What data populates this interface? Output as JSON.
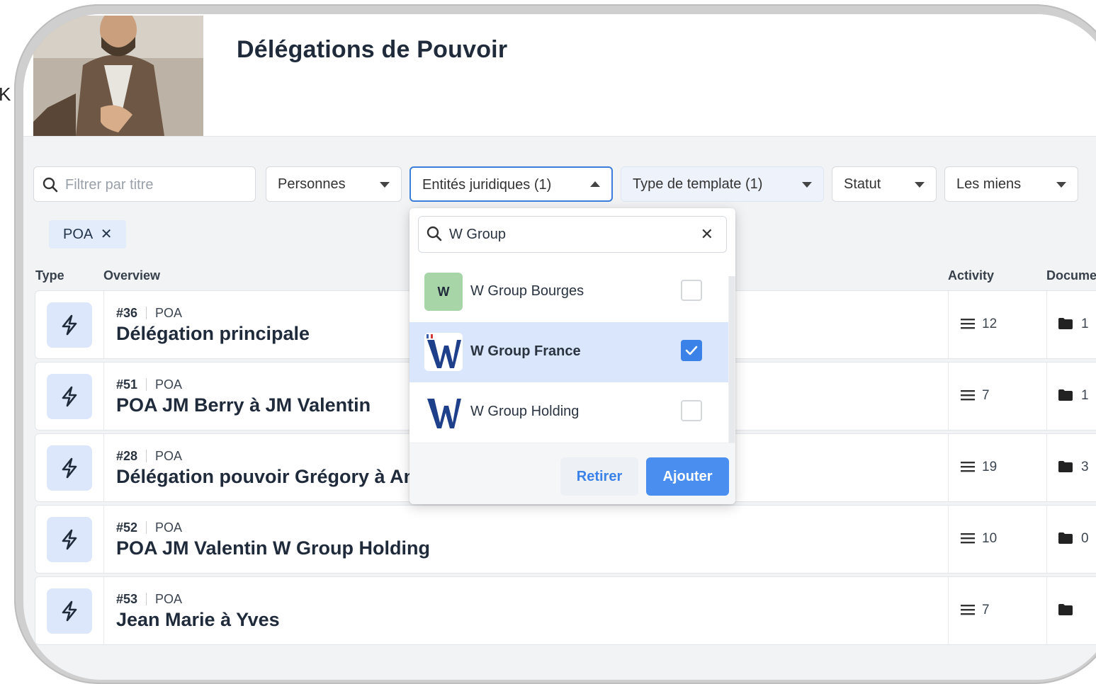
{
  "edge_glyph": "K",
  "page": {
    "title": "Délégations de Pouvoir"
  },
  "filters": {
    "search_placeholder": "Filtrer par titre",
    "personnes": "Personnes",
    "entites": "Entités juridiques (1)",
    "type_template": "Type de template (1)",
    "statut": "Statut",
    "les_miens": "Les miens"
  },
  "active_chip": {
    "label": "POA",
    "remove_glyph": "✕"
  },
  "columns": {
    "type": "Type",
    "overview": "Overview",
    "activity": "Activity",
    "documents": "Docume"
  },
  "rows": [
    {
      "id": "#36",
      "type": "POA",
      "title": "Délégation principale",
      "activity": "12",
      "docs": "1"
    },
    {
      "id": "#51",
      "type": "POA",
      "title": "POA JM Berry à JM Valentin",
      "activity": "7",
      "docs": "1"
    },
    {
      "id": "#28",
      "type": "POA",
      "title": "Délégation pouvoir Grégory à Anr",
      "activity": "19",
      "docs": "3"
    },
    {
      "id": "#52",
      "type": "POA",
      "title": "POA JM Valentin W Group Holding",
      "activity": "10",
      "docs": "0"
    },
    {
      "id": "#53",
      "type": "POA",
      "title": "Jean Marie à Yves",
      "activity": "7",
      "docs": ""
    }
  ],
  "dropdown": {
    "search_value": "W Group",
    "clear_glyph": "✕",
    "options": [
      {
        "name": "W Group Bourges",
        "logo_text": "W",
        "checked": false
      },
      {
        "name": "W Group France",
        "checked": true
      },
      {
        "name": "W Group Holding",
        "checked": false
      }
    ],
    "retirer": "Retirer",
    "ajouter": "Ajouter"
  },
  "colors": {
    "accent": "#3b82e8",
    "selected_row": "#d9e6fb",
    "type_icon_bg": "#dce7fb",
    "logo_green": "#a8d5a8",
    "logo_navy": "#1e3f8a"
  },
  "icons": [
    "search-icon",
    "chevron-down-icon",
    "chevron-up-icon",
    "close-icon",
    "bolt-icon",
    "list-lines-icon",
    "folder-icon",
    "check-icon"
  ]
}
